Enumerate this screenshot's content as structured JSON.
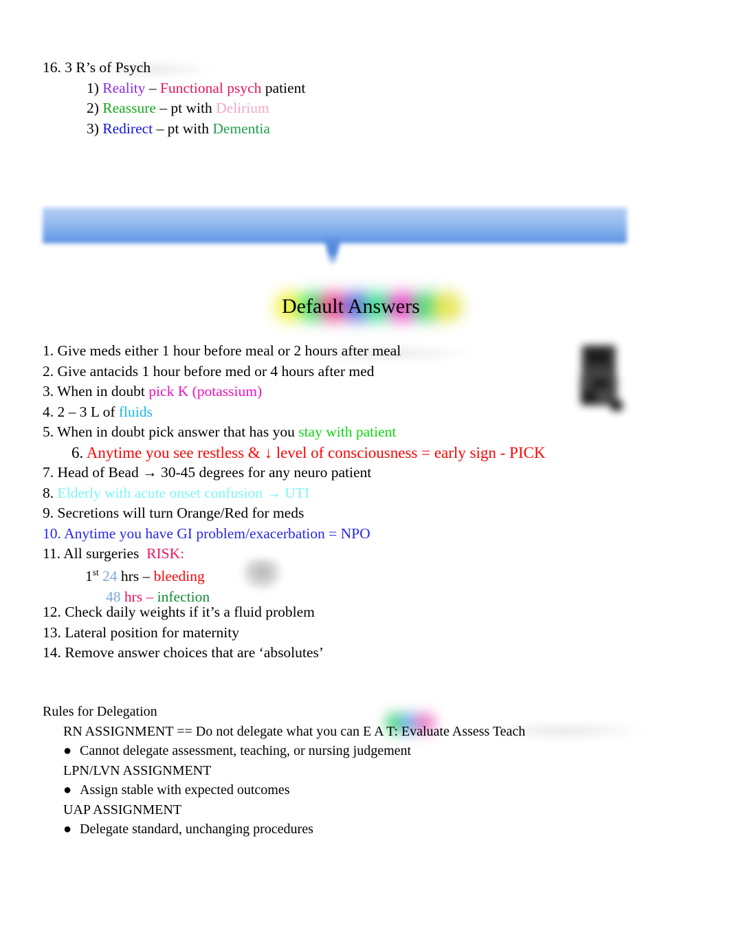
{
  "document": {
    "title": "Default Answers"
  },
  "psych_section": {
    "heading": "16. 3 R’s of Psych",
    "items": [
      {
        "marker": "1)",
        "r_word": "Reality",
        "dash": "–",
        "rest_colored": "Functional psych",
        "rest_plain": "patient"
      },
      {
        "marker": "2)",
        "r_word": "Reassure",
        "dash": "–",
        "rest_plain_pre": "pt with",
        "rest_colored": "Delirium"
      },
      {
        "marker": "3)",
        "r_word": "Redirect",
        "dash": "–",
        "rest_plain_pre": "pt with",
        "rest_colored": "Dementia"
      }
    ]
  },
  "default_answers": {
    "title": "Default Answers",
    "items": [
      {
        "number": "1.",
        "text": "Give meds either 1 hour before meal or 2 hours after meal"
      },
      {
        "number": "2.",
        "text": "Give antacids 1 hour before med or 4 hours after med"
      },
      {
        "number": "3.",
        "text_plain": "When in doubt",
        "text_colored": "pick K (potassium)"
      },
      {
        "number": "4.",
        "text_plain": "2 – 3 L of",
        "text_colored": "fluids"
      },
      {
        "number": "5.",
        "text_plain": "When in doubt pick answer that has you",
        "text_colored": "stay with patient"
      },
      {
        "number": "6.",
        "text_colored": "Anytime you see restless & ↓ level of consciousness = early sign - PICK"
      },
      {
        "number": "7.",
        "text": "Head of Bead → 30-45 degrees for any neuro patient"
      },
      {
        "number": "8.",
        "text_colored": "Elderly with acute onset confusion  → UTI"
      },
      {
        "number": "9.",
        "text": "Secretions will turn Orange/Red for meds"
      },
      {
        "number": "10.",
        "text_colored": "Anytime you have GI problem/exacerbation = NPO"
      },
      {
        "number": "11.",
        "text_plain": "All surgeries",
        "text_colored": "RISK:"
      },
      {
        "number": "12.",
        "text": "Check daily weights if it’s a fluid problem"
      },
      {
        "number": "13.",
        "text": "Lateral position for maternity"
      },
      {
        "number": "14.",
        "text": "Remove answer choices that are ‘absolutes’"
      }
    ],
    "risk_sub": [
      {
        "prefix": "1",
        "prefix_sup": "st",
        "hours": "24",
        "unit": "hrs",
        "dash": "–",
        "outcome": "bleeding"
      },
      {
        "hours": "48",
        "unit": "hrs",
        "dash": "–",
        "outcome": "infection"
      }
    ]
  },
  "delegation": {
    "heading": "Rules for Delegation",
    "rn_label": "RN ASSIGNMENT == Do not delegate what you can",
    "rn_acronym": "E A T:",
    "rn_expansion": "Evaluate Assess Teach",
    "rn_bullet": "Cannot delegate assessment, teaching, or nursing judgement",
    "lpn_label": "LPN/LVN ASSIGNMENT",
    "lpn_bullet": "Assign stable with expected outcomes",
    "uap_label": "UAP ASSIGNMENT",
    "uap_bullet": "Delegate standard, unchanging procedures",
    "bullet_glyph": "●"
  },
  "colors": {
    "reality": "#8a2be2",
    "functional_psych": "#e8145c",
    "reassure": "#17a81a",
    "delirium": "#f4a7c4",
    "redirect": "#1414e0",
    "dementia": "#1f9e4a",
    "potassium": "#ee11bb",
    "fluids": "#19b6f0",
    "stay_with_patient": "#11d711",
    "item6_red": "#fc0505",
    "item8_cyan": "#7df5f5",
    "item10_blue": "#2626ec",
    "risk_pink": "#f0155f",
    "hours_blue": "#7fa7dd",
    "bleeding_red": "#fc0505",
    "infection_green": "#0f8a33",
    "banner_blue_top": "#b3cdf3",
    "banner_blue_bottom": "#5b8fe0"
  }
}
